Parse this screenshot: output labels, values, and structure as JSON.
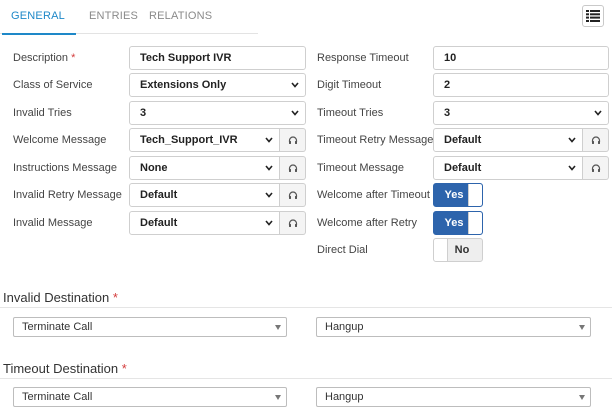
{
  "tabs": [
    {
      "label": "GENERAL",
      "active": true
    },
    {
      "label": "ENTRIES",
      "active": false
    },
    {
      "label": "RELATIONS",
      "active": false
    }
  ],
  "toolbar": {
    "list_icon": "list-icon"
  },
  "left_fields": {
    "description": {
      "label": "Description",
      "required_mark": "*",
      "value": "Tech Support IVR"
    },
    "class_of_service": {
      "label": "Class of Service",
      "value": "Extensions Only"
    },
    "invalid_tries": {
      "label": "Invalid Tries",
      "value": "3"
    },
    "welcome_message": {
      "label": "Welcome Message",
      "value": "Tech_Support_IVR"
    },
    "instructions_message": {
      "label": "Instructions Message",
      "value": "None"
    },
    "invalid_retry_message": {
      "label": "Invalid Retry Message",
      "value": "Default"
    },
    "invalid_message": {
      "label": "Invalid Message",
      "value": "Default"
    }
  },
  "right_fields": {
    "response_timeout": {
      "label": "Response Timeout",
      "value": "10"
    },
    "digit_timeout": {
      "label": "Digit Timeout",
      "value": "2"
    },
    "timeout_tries": {
      "label": "Timeout Tries",
      "value": "3"
    },
    "timeout_retry_message": {
      "label": "Timeout Retry Message",
      "value": "Default"
    },
    "timeout_message": {
      "label": "Timeout Message",
      "value": "Default"
    },
    "welcome_after_timeout": {
      "label": "Welcome after Timeout",
      "value": "Yes",
      "on": true
    },
    "welcome_after_retry": {
      "label": "Welcome after Retry",
      "value": "Yes",
      "on": true
    },
    "direct_dial": {
      "label": "Direct Dial",
      "value": "No",
      "on": false
    }
  },
  "invalid_destination": {
    "title": "Invalid Destination",
    "required_mark": "*",
    "type": "Terminate Call",
    "target": "Hangup"
  },
  "timeout_destination": {
    "title": "Timeout Destination",
    "required_mark": "*",
    "type": "Terminate Call",
    "target": "Hangup"
  },
  "colors": {
    "accent": "#1e88c8",
    "toggle_on": "#2d64ac",
    "required": "#d43c3c"
  }
}
